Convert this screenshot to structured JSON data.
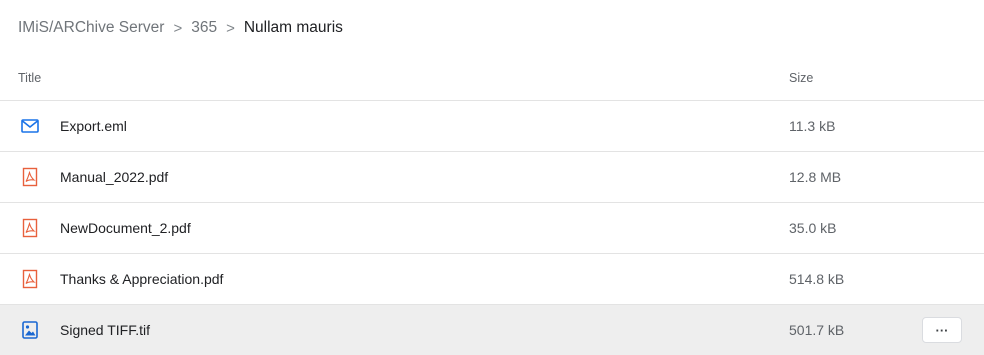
{
  "breadcrumb": {
    "items": [
      "IMiS/ARChive Server",
      "365",
      "Nullam mauris"
    ],
    "separator": ">"
  },
  "table": {
    "headers": {
      "title": "Title",
      "size": "Size"
    },
    "rows": [
      {
        "name": "Export.eml",
        "size": "11.3 kB",
        "icon": "email-icon"
      },
      {
        "name": "Manual_2022.pdf",
        "size": "12.8 MB",
        "icon": "pdf-icon"
      },
      {
        "name": "NewDocument_2.pdf",
        "size": "35.0 kB",
        "icon": "pdf-icon"
      },
      {
        "name": "Thanks & Appreciation.pdf",
        "size": "514.8 kB",
        "icon": "pdf-icon"
      },
      {
        "name": "Signed TIFF.tif",
        "size": "501.7 kB",
        "icon": "image-file-icon",
        "selected": true
      }
    ],
    "more_button_label": "···"
  },
  "colors": {
    "email_icon": "#1a73e8",
    "pdf_icon": "#e8603c",
    "image_icon": "#1967d2",
    "selected_row": "#eeeeee"
  }
}
